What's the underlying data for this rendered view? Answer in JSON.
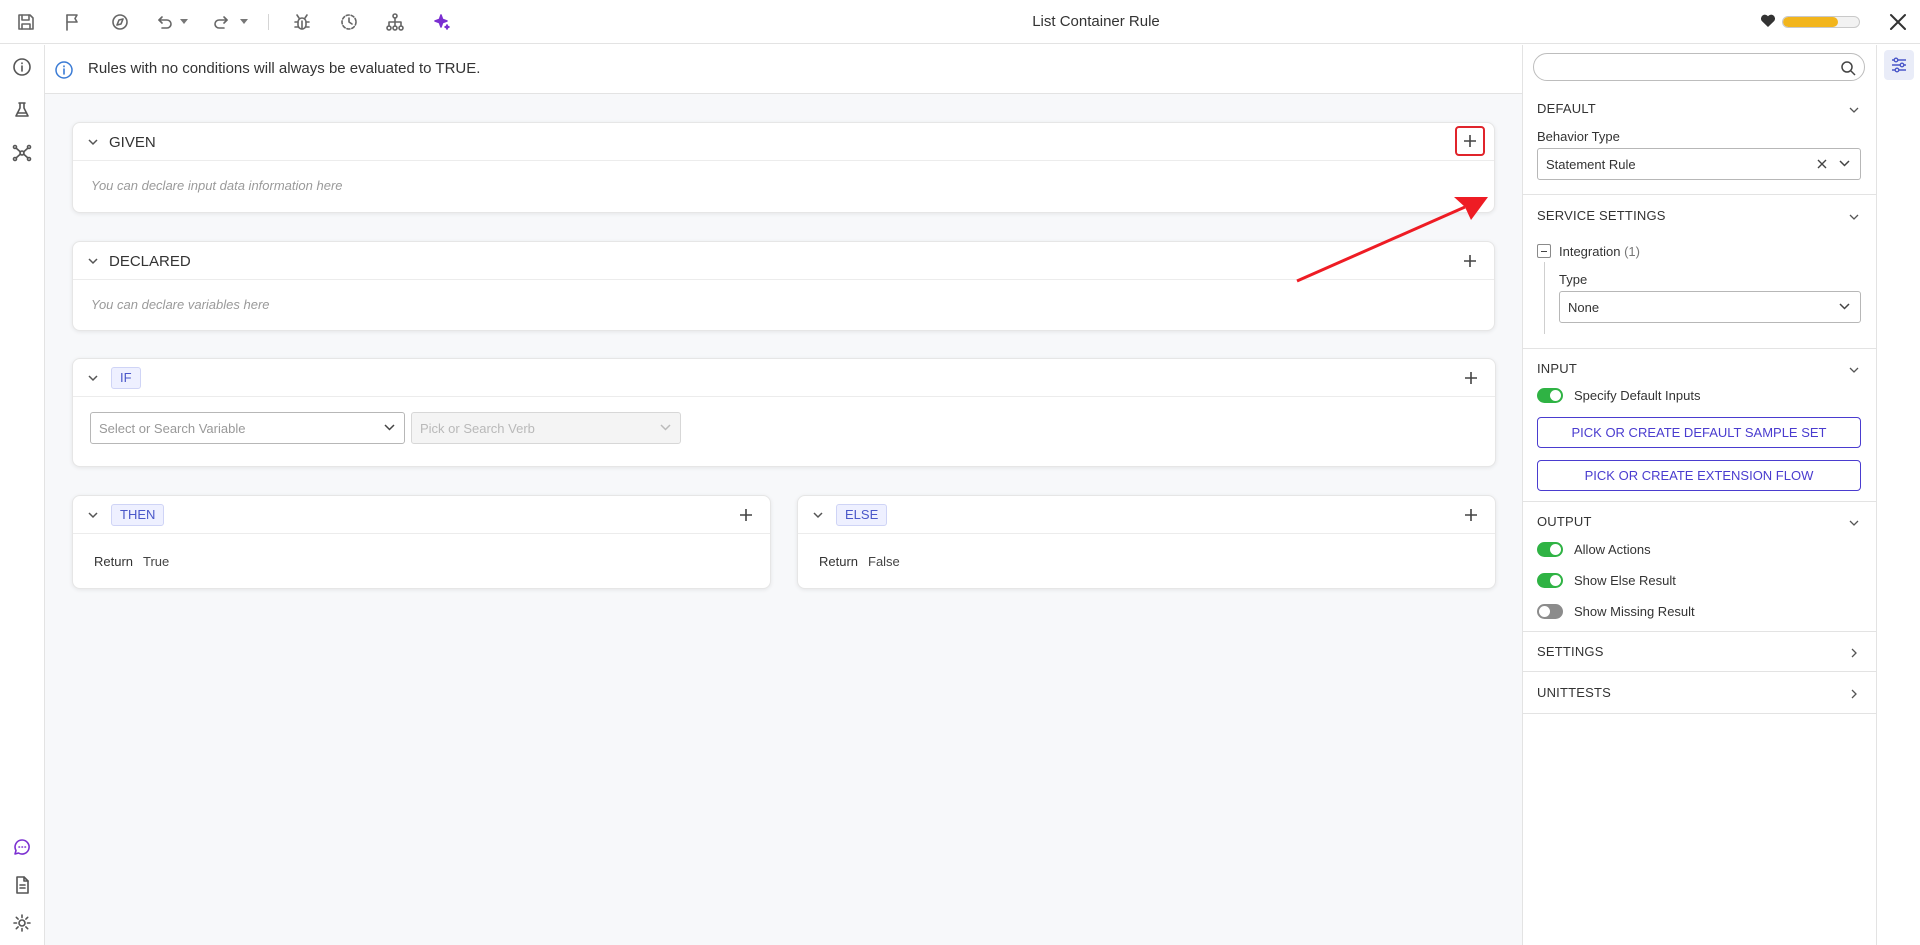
{
  "toolbar": {
    "title": "List Container Rule",
    "icons": [
      "save-icon",
      "flag-icon",
      "compass-icon",
      "undo-icon",
      "redo-icon",
      "bug-icon",
      "history-icon",
      "hierarchy-icon",
      "sparkle-icon"
    ],
    "health_progress": 0.72,
    "colors": {
      "accent": "#4a3ccf",
      "progress": "#f2b51c"
    }
  },
  "info": {
    "text": "Rules with no conditions will always be evaluated to TRUE."
  },
  "given": {
    "title": "GIVEN",
    "hint": "You can declare input data information here"
  },
  "declared": {
    "title": "DECLARED",
    "hint": "You can declare variables here"
  },
  "if": {
    "tag": "IF",
    "variable_placeholder": "Select or Search Variable",
    "verb_placeholder": "Pick or Search Verb"
  },
  "then": {
    "tag": "THEN",
    "return_label": "Return",
    "return_value": "True"
  },
  "else": {
    "tag": "ELSE",
    "return_label": "Return",
    "return_value": "False"
  },
  "panel": {
    "search_placeholder": "",
    "default": {
      "title": "DEFAULT",
      "behavior_label": "Behavior Type",
      "behavior_value": "Statement Rule"
    },
    "service": {
      "title": "SERVICE SETTINGS",
      "integration_label": "Integration",
      "integration_count": "(1)",
      "type_label": "Type",
      "type_value": "None"
    },
    "input": {
      "title": "INPUT",
      "specify_label": "Specify Default Inputs",
      "specify_on": true,
      "btn_sample": "PICK OR CREATE DEFAULT SAMPLE SET",
      "btn_flow": "PICK OR CREATE EXTENSION FLOW"
    },
    "output": {
      "title": "OUTPUT",
      "allow_actions": "Allow Actions",
      "allow_actions_on": true,
      "show_else": "Show Else Result",
      "show_else_on": true,
      "show_missing": "Show Missing Result",
      "show_missing_on": false
    },
    "settings": {
      "title": "SETTINGS"
    },
    "unittests": {
      "title": "UNITTESTS"
    }
  }
}
